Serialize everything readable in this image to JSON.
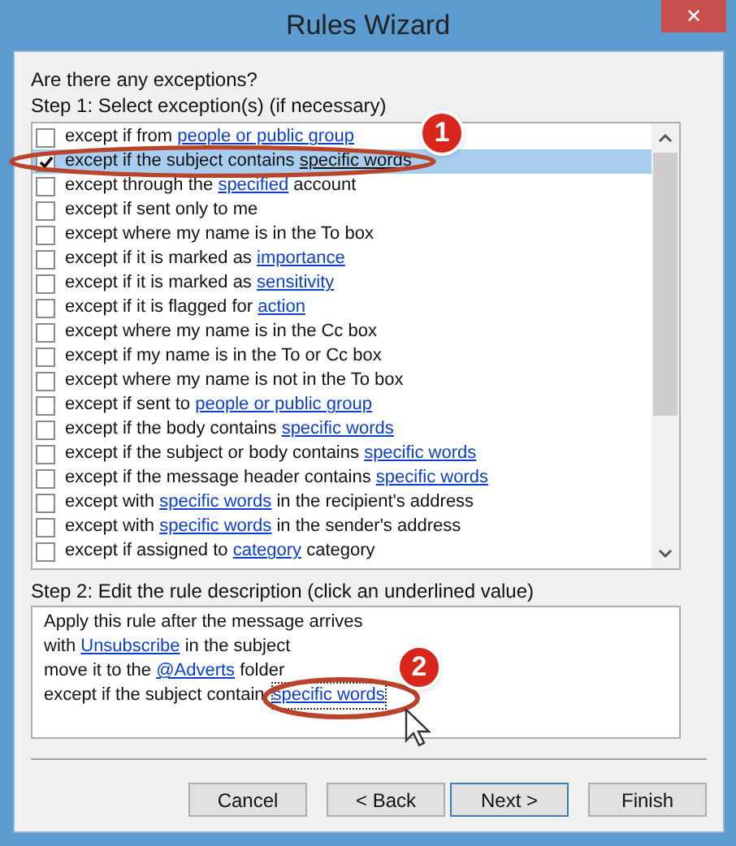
{
  "window": {
    "title": "Rules Wizard",
    "close": "✕"
  },
  "question": "Are there any exceptions?",
  "step1": "Step 1: Select exception(s) (if necessary)",
  "exceptions": [
    {
      "checked": false,
      "selected": false,
      "parts": [
        {
          "text": "except if from ",
          "link": false
        },
        {
          "text": "people or public group",
          "link": true
        }
      ]
    },
    {
      "checked": true,
      "selected": true,
      "parts": [
        {
          "text": "except if the subject contains ",
          "link": false
        },
        {
          "text": "specific words",
          "link": true
        }
      ]
    },
    {
      "checked": false,
      "selected": false,
      "parts": [
        {
          "text": "except through the ",
          "link": false
        },
        {
          "text": "specified",
          "link": true
        },
        {
          "text": " account",
          "link": false
        }
      ]
    },
    {
      "checked": false,
      "selected": false,
      "parts": [
        {
          "text": "except if sent only to me",
          "link": false
        }
      ]
    },
    {
      "checked": false,
      "selected": false,
      "parts": [
        {
          "text": "except where my name is in the To box",
          "link": false
        }
      ]
    },
    {
      "checked": false,
      "selected": false,
      "parts": [
        {
          "text": "except if it is marked as ",
          "link": false
        },
        {
          "text": "importance",
          "link": true
        }
      ]
    },
    {
      "checked": false,
      "selected": false,
      "parts": [
        {
          "text": "except if it is marked as ",
          "link": false
        },
        {
          "text": "sensitivity",
          "link": true
        }
      ]
    },
    {
      "checked": false,
      "selected": false,
      "parts": [
        {
          "text": "except if it is flagged for ",
          "link": false
        },
        {
          "text": "action",
          "link": true
        }
      ]
    },
    {
      "checked": false,
      "selected": false,
      "parts": [
        {
          "text": "except where my name is in the Cc box",
          "link": false
        }
      ]
    },
    {
      "checked": false,
      "selected": false,
      "parts": [
        {
          "text": "except if my name is in the To or Cc box",
          "link": false
        }
      ]
    },
    {
      "checked": false,
      "selected": false,
      "parts": [
        {
          "text": "except where my name is not in the To box",
          "link": false
        }
      ]
    },
    {
      "checked": false,
      "selected": false,
      "parts": [
        {
          "text": "except if sent to ",
          "link": false
        },
        {
          "text": "people or public group",
          "link": true
        }
      ]
    },
    {
      "checked": false,
      "selected": false,
      "parts": [
        {
          "text": "except if the body contains ",
          "link": false
        },
        {
          "text": "specific words",
          "link": true
        }
      ]
    },
    {
      "checked": false,
      "selected": false,
      "parts": [
        {
          "text": "except if the subject or body contains ",
          "link": false
        },
        {
          "text": "specific words",
          "link": true
        }
      ]
    },
    {
      "checked": false,
      "selected": false,
      "parts": [
        {
          "text": "except if the message header contains ",
          "link": false
        },
        {
          "text": "specific words",
          "link": true
        }
      ]
    },
    {
      "checked": false,
      "selected": false,
      "parts": [
        {
          "text": "except with ",
          "link": false
        },
        {
          "text": "specific words",
          "link": true
        },
        {
          "text": " in the recipient's address",
          "link": false
        }
      ]
    },
    {
      "checked": false,
      "selected": false,
      "parts": [
        {
          "text": "except with ",
          "link": false
        },
        {
          "text": "specific words",
          "link": true
        },
        {
          "text": " in the sender's address",
          "link": false
        }
      ]
    },
    {
      "checked": false,
      "selected": false,
      "parts": [
        {
          "text": "except if assigned to ",
          "link": false
        },
        {
          "text": "category",
          "link": true
        },
        {
          "text": " category",
          "link": false
        }
      ]
    }
  ],
  "step2": "Step 2: Edit the rule description (click an underlined value)",
  "description": [
    [
      {
        "text": "Apply this rule after the message arrives",
        "link": false
      }
    ],
    [
      {
        "text": "with ",
        "link": false
      },
      {
        "text": "Unsubscribe",
        "link": true
      },
      {
        "text": " in the subject",
        "link": false
      }
    ],
    [
      {
        "text": "move it to the ",
        "link": false
      },
      {
        "text": "@Adverts",
        "link": true
      },
      {
        "text": " folder",
        "link": false
      }
    ],
    [
      {
        "text": "except if the subject contain",
        "link": false
      },
      {
        "text": "specific words",
        "link": true
      }
    ]
  ],
  "callouts": [
    "1",
    "2"
  ],
  "buttons": [
    "Cancel",
    "< Back",
    "Next >",
    "Finish"
  ]
}
